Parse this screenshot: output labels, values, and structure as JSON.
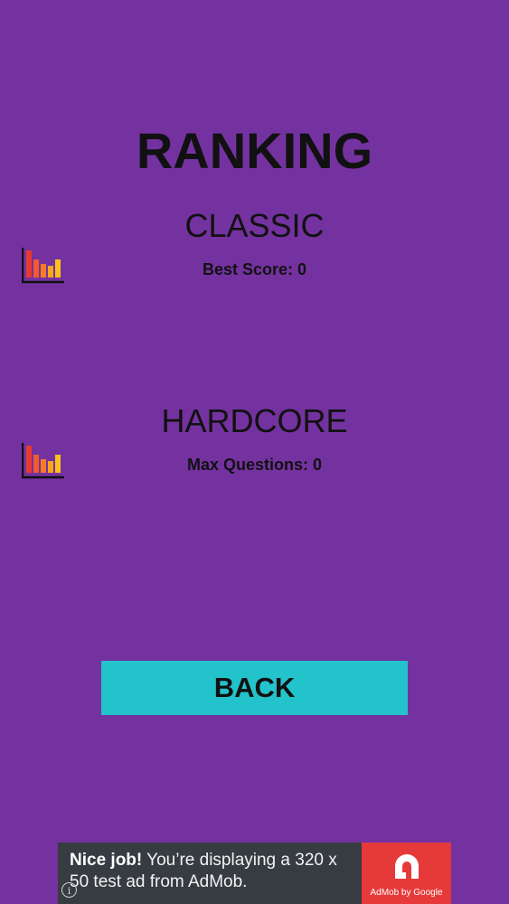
{
  "screen": {
    "title": "RANKING",
    "background": "#7432a0"
  },
  "classic": {
    "title": "CLASSIC",
    "label": "Best Score: 0",
    "icon": "bar-chart-icon"
  },
  "hardcore": {
    "title": "HARDCORE",
    "label": "Max Questions: 0",
    "icon": "bar-chart-icon"
  },
  "back_button": {
    "label": "BACK",
    "color": "#23c3cc"
  },
  "ad": {
    "headline": "Nice job!",
    "message": " You’re displaying a 320 x 50 test ad from AdMob.",
    "brand": "AdMob by Google",
    "info_icon": "info-icon",
    "logo_icon": "admob-logo-icon",
    "background": "#373c42",
    "brand_color": "#e63a3a"
  }
}
